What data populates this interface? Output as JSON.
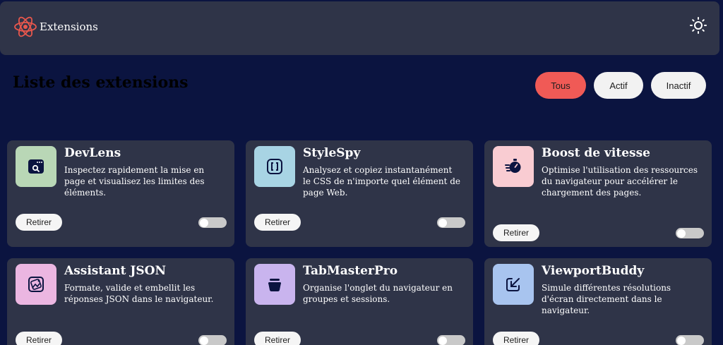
{
  "header": {
    "app_name": "Extensions",
    "logo_icon": "atom-logo-icon",
    "theme_icon": "sun-icon"
  },
  "main": {
    "title": "Liste des extensions",
    "filters": [
      {
        "label": "Tous",
        "active": true
      },
      {
        "label": "Actif",
        "active": false
      },
      {
        "label": "Inactif",
        "active": false
      }
    ]
  },
  "extensions": [
    {
      "name": "DevLens",
      "description": "Inspectez rapidement la mise en page et visualisez les limites des éléments.",
      "icon": "browser-search-icon",
      "icon_bg": "#b9d7b6",
      "remove_label": "Retirer",
      "enabled": false
    },
    {
      "name": "StyleSpy",
      "description": "Analysez et copiez instantanément le CSS de n'importe quel élément de page Web.",
      "icon": "brackets-icon",
      "icon_bg": "#a8d4e4",
      "remove_label": "Retirer",
      "enabled": false
    },
    {
      "name": "Boost de vitesse",
      "description": "Optimise l'utilisation des ressources du navigateur pour accélérer le chargement des pages.",
      "icon": "speed-timer-icon",
      "icon_bg": "#f9ccd2",
      "remove_label": "Retirer",
      "enabled": false
    },
    {
      "name": "Assistant JSON",
      "description": "Formate, valide et embellit les réponses JSON dans le navigateur.",
      "icon": "json-image-icon",
      "icon_bg": "#ebb6e1",
      "remove_label": "Retirer",
      "enabled": false
    },
    {
      "name": "TabMasterPro",
      "description": "Organise l'onglet du navigateur en groupes et sessions.",
      "icon": "basket-icon",
      "icon_bg": "#c9b4ee",
      "remove_label": "Retirer",
      "enabled": false
    },
    {
      "name": "ViewportBuddy",
      "description": "Simule différentes résolutions d'écran directement dans le navigateur.",
      "icon": "resize-arrow-icon",
      "icon_bg": "#a8c4ef",
      "remove_label": "Retirer",
      "enabled": false
    }
  ],
  "colors": {
    "background": "#0b1440",
    "card": "#2f3448",
    "accent": "#f05a56"
  }
}
